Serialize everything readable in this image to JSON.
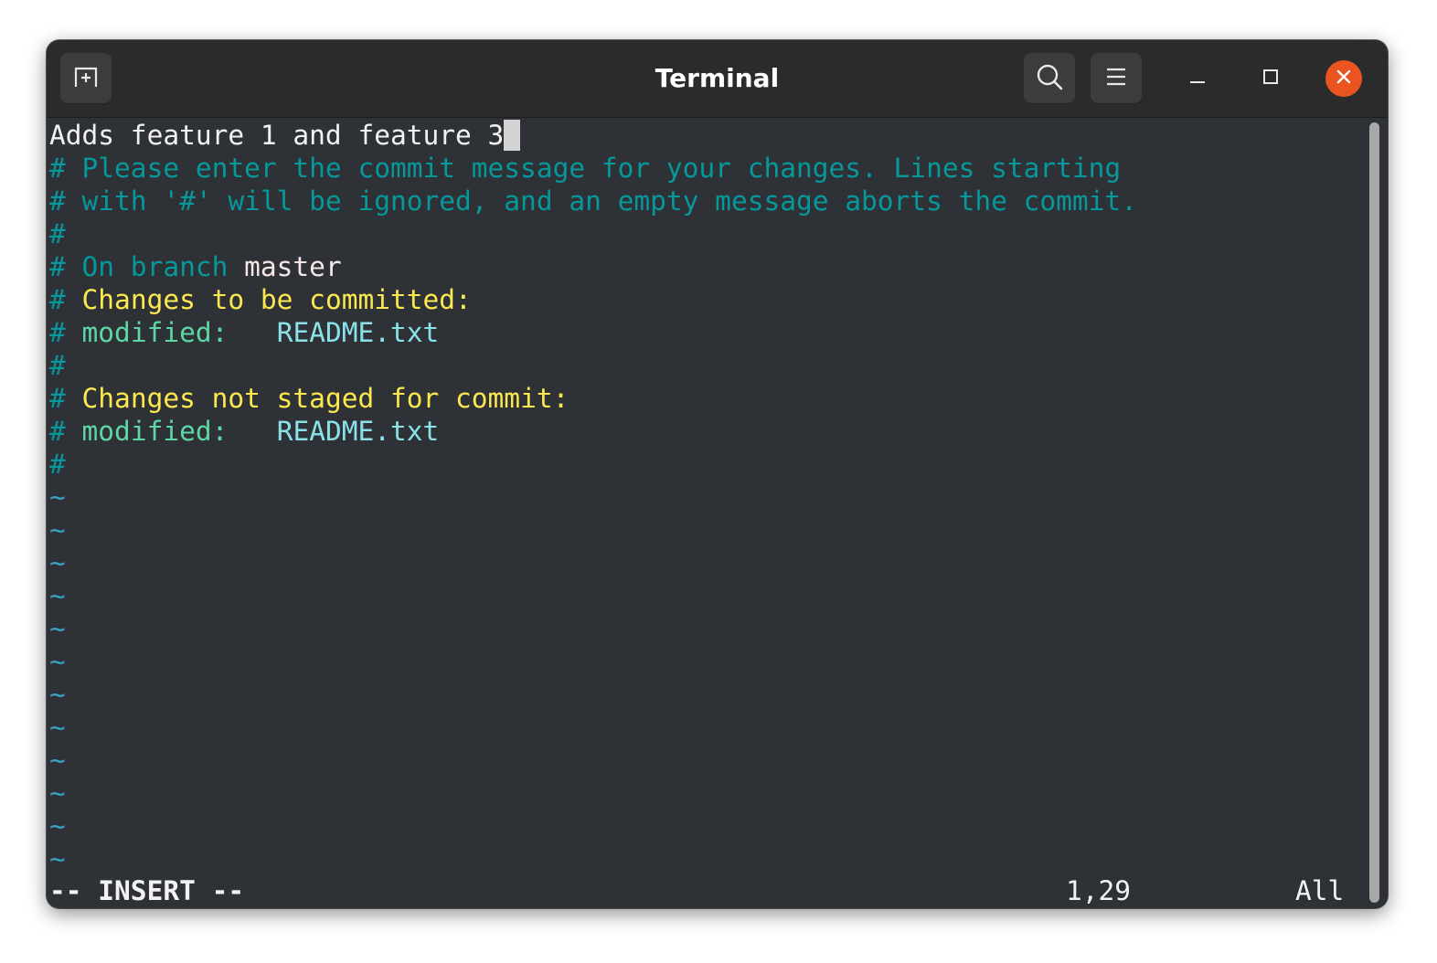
{
  "window": {
    "title": "Terminal",
    "icons": {
      "new_tab": "new-tab-icon",
      "search": "search-icon",
      "menu": "hamburger-menu-icon",
      "minimize": "minimize-icon",
      "maximize": "maximize-icon",
      "close": "close-icon"
    },
    "colors": {
      "accent_close": "#e95420",
      "background": "#2e3236",
      "titlebar": "#2b2b2b"
    }
  },
  "editor": {
    "commit_message": "Adds feature 1 and feature 3",
    "comment_lines": {
      "l1": "# Please enter the commit message for your changes. Lines starting",
      "l2": "# with '#' will be ignored, and an empty message aborts the commit.",
      "l3": "#",
      "branch_prefix": "# On branch ",
      "branch_name": "master",
      "staged_hash": "# ",
      "staged_header": "Changes to be committed:",
      "staged_mod_hash": "# ",
      "staged_mod_label": "modified:",
      "staged_mod_file": "README.txt",
      "l8": "#",
      "unstaged_hash": "# ",
      "unstaged_header": "Changes not staged for commit:",
      "unstaged_mod_hash": "# ",
      "unstaged_mod_label": "modified:",
      "unstaged_mod_file": "README.txt",
      "l12": "#"
    },
    "tilde": "~",
    "status": {
      "mode": "-- INSERT --",
      "position": "1,29",
      "scroll": "All"
    }
  }
}
